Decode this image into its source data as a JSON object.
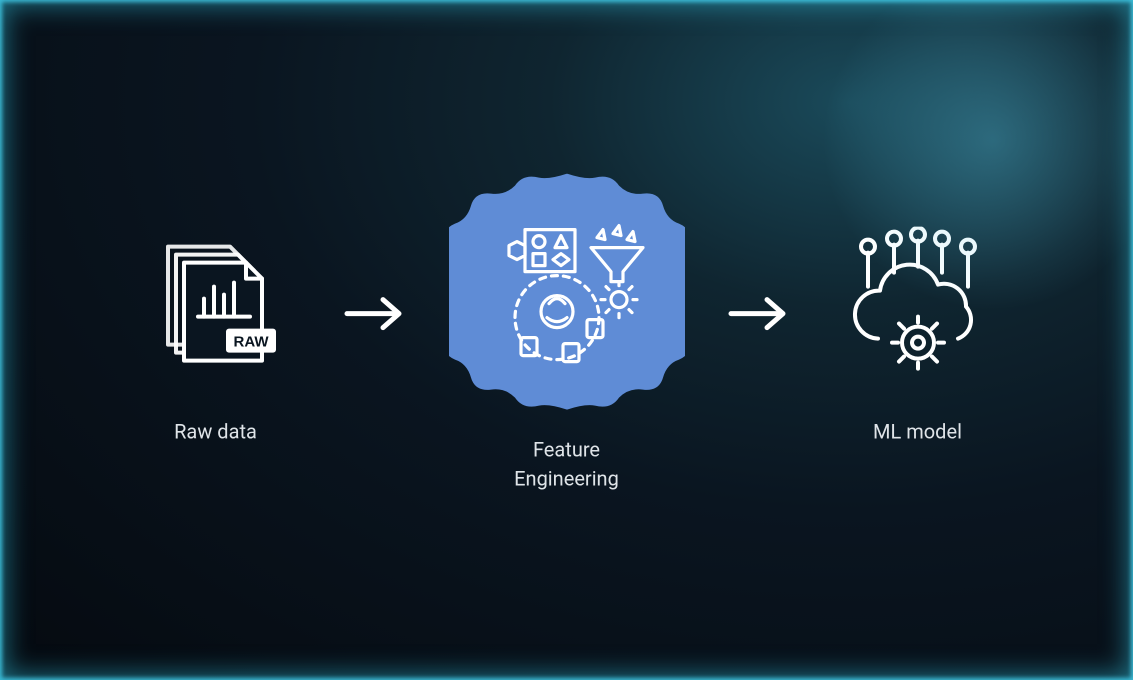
{
  "colors": {
    "line_white": "#ffffff",
    "badge_blue": "#5f8cd6",
    "text": "#dfe4e8"
  },
  "stages": {
    "raw": {
      "label": "Raw data",
      "icon": "raw-data-documents-icon",
      "badge_text": "RAW"
    },
    "feature": {
      "label": "Feature\nEngineering",
      "icon": "feature-engineering-badge-icon"
    },
    "ml": {
      "label": "ML model",
      "icon": "ml-model-cloud-gear-icon"
    }
  },
  "flow": [
    "raw",
    "arrow",
    "feature",
    "arrow",
    "ml"
  ]
}
